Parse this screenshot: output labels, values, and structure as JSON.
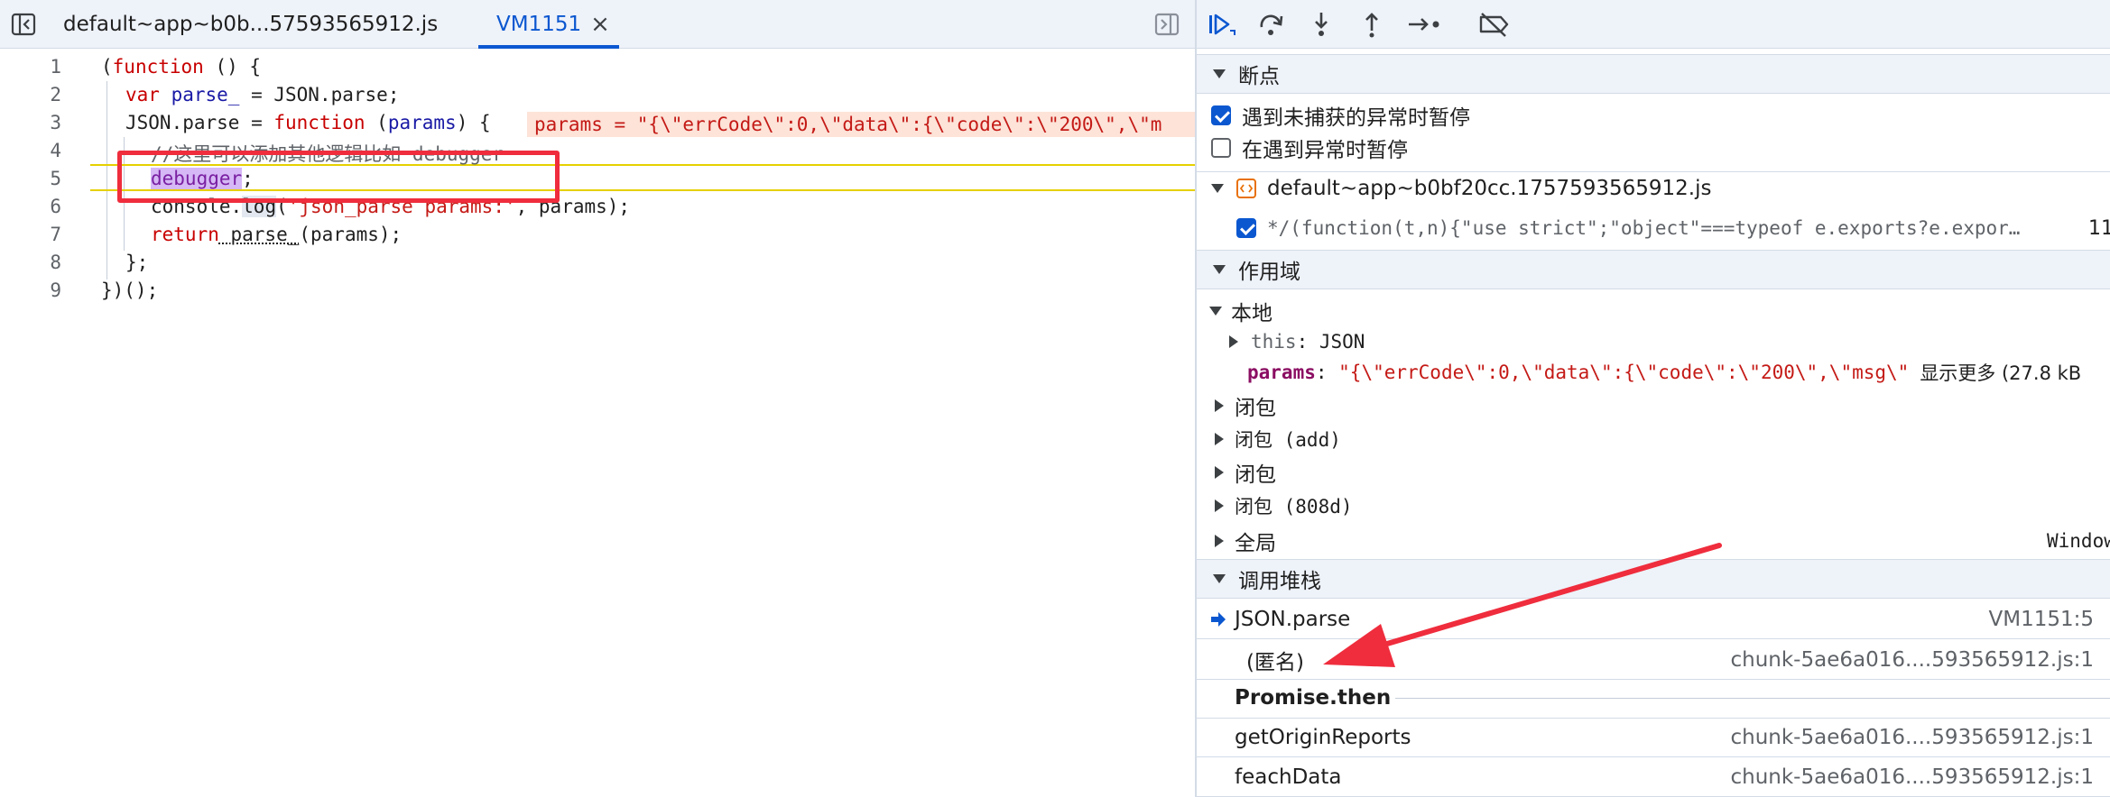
{
  "editor": {
    "tabs": [
      {
        "label": "default~app~b0b...57593565912.js"
      },
      {
        "label": "VM1151",
        "close": "×"
      }
    ],
    "line_numbers": [
      "1",
      "2",
      "3",
      "4",
      "5",
      "6",
      "7",
      "8",
      "9"
    ],
    "lines": {
      "l1": {
        "open": "(",
        "kw": "function",
        "rest": " () {"
      },
      "l2": {
        "kw": "var",
        "var": " parse_",
        "rest": " = JSON.parse;"
      },
      "l3": {
        "a": "JSON.parse = ",
        "kw": "function",
        "b": " (",
        "param": "params",
        "c": ") {"
      },
      "l3_inline_value": "params = \"{\\\"errCode\\\":0,\\\"data\\\":{\\\"code\\\":\\\"200\\\",\\\"m",
      "l4": {
        "comment": "//这里可以添加其他逻辑比如 debugger"
      },
      "l5": {
        "dbg": "debugger",
        "rest": ";"
      },
      "l6": {
        "a": "console.",
        "fn": "log",
        "b": "(",
        "str": "'json_parse params:'",
        "c": ", params);"
      },
      "l7": {
        "kw": "return",
        "fn": " parse_",
        "rest": "(params);"
      },
      "l8": {
        "text": "};"
      },
      "l9": {
        "text": "})();"
      }
    }
  },
  "sidebar": {
    "breakpoints": {
      "title": "断点",
      "pause_uncaught_label": "遇到未捕获的异常时暂停",
      "pause_uncaught_checked": true,
      "pause_caught_label": "在遇到异常时暂停",
      "pause_caught_checked": false,
      "file_name": "default~app~b0bf20cc.1757593565912.js",
      "bp_code": "*/(function(t,n){\"use strict\";\"object\"===typeof e.exports?e.expor…",
      "bp_line": "11"
    },
    "scope": {
      "title": "作用域",
      "local_label": "本地",
      "this_key": "this",
      "this_value": "JSON",
      "params_key": "params",
      "params_value": "\"{\\\"errCode\\\":0,\\\"data\\\":{\\\"code\\\":\\\"200\\\",\\\"msg\\\"",
      "show_more": "显示更多 (27.8 kB",
      "closures": [
        "闭包",
        "闭包 (add)",
        "闭包",
        "闭包 (808d)"
      ],
      "global_label": "全局",
      "global_value": "Window"
    },
    "callstack": {
      "title": "调用堆栈",
      "frames": [
        {
          "name": "JSON.parse",
          "loc": "VM1151:5"
        },
        {
          "name": "(匿名)",
          "loc": "chunk-5ae6a016....593565912.js:1"
        }
      ],
      "async_sep": "Promise.then",
      "frames2": [
        {
          "name": "getOriginReports",
          "loc": "chunk-5ae6a016....593565912.js:1"
        },
        {
          "name": "feachData",
          "loc": "chunk-5ae6a016....593565912.js:1"
        }
      ]
    }
  },
  "colors": {
    "accent": "#0b57d0",
    "annotation_red": "#ef2d3d",
    "keyword": "#c80000",
    "string": "#c41a16"
  },
  "icons": [
    "toggle-navigator-icon",
    "toggle-debugger-icon",
    "resume-icon",
    "step-over-icon",
    "step-into-icon",
    "step-out-icon",
    "step-icon",
    "deactivate-breakpoints-icon",
    "source-file-icon",
    "current-frame-arrow-icon"
  ]
}
